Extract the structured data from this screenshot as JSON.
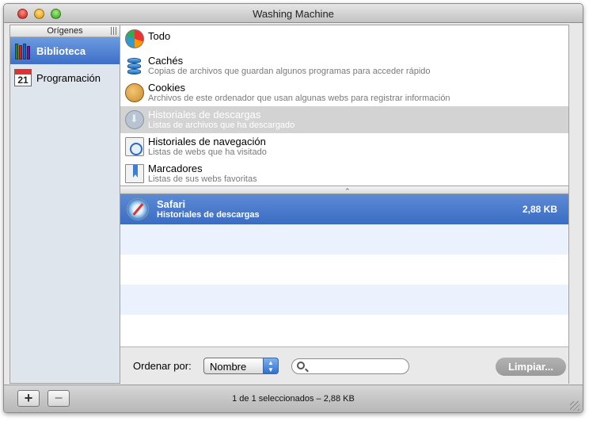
{
  "window": {
    "title": "Washing Machine"
  },
  "sidebar": {
    "header": "Orígenes",
    "items": [
      {
        "label": "Biblioteca",
        "icon": "library-books-icon",
        "selected": true
      },
      {
        "label": "Programación",
        "icon": "calendar-icon",
        "calendar_day": "21",
        "selected": false
      }
    ]
  },
  "categories": [
    {
      "title": "Todo",
      "subtitle": "",
      "icon": "pie-chart-icon"
    },
    {
      "title": "Cachés",
      "subtitle": "Copias de archivos que guardan algunos programas para acceder rápido",
      "icon": "database-icon"
    },
    {
      "title": "Cookies",
      "subtitle": "Archivos de este ordenador que usan algunas webs para registrar información",
      "icon": "cookie-icon"
    },
    {
      "title": "Historiales de descargas",
      "subtitle": "Listas de archivos que ha descargado",
      "icon": "download-icon",
      "highlighted": true
    },
    {
      "title": "Historiales de navegación",
      "subtitle": "Listas de webs que ha visitado",
      "icon": "history-clock-icon"
    },
    {
      "title": "Marcadores",
      "subtitle": "Listas de sus webs favoritas",
      "icon": "bookmark-icon"
    }
  ],
  "results": {
    "rows": [
      {
        "title": "Safari",
        "subtitle": "Historiales de descargas",
        "size": "2,88 KB",
        "icon": "safari-compass-icon"
      }
    ]
  },
  "options": {
    "sort_label": "Ordenar por:",
    "sort_value": "Nombre",
    "search_placeholder": "",
    "clean_button": "Limpiar..."
  },
  "statusbar": {
    "add_label": "+",
    "remove_label": "−",
    "status": "1 de 1 seleccionados – 2,88 KB"
  },
  "colors": {
    "selection_blue": "#3d6fc8",
    "highlight_gray": "#d3d3d3",
    "alt_row": "#ecf2fd"
  }
}
